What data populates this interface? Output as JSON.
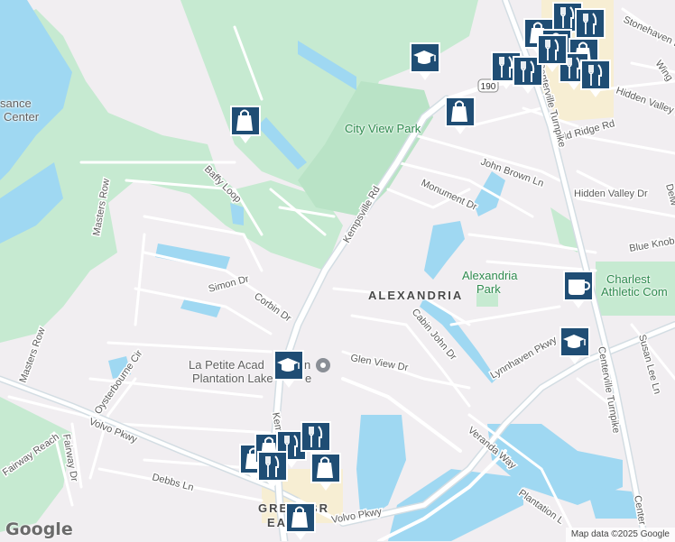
{
  "map": {
    "road_labels": [
      {
        "id": "kempsville-rd",
        "text": "Kempsville Rd"
      },
      {
        "id": "kempsville-rd-south",
        "text": "Kem"
      },
      {
        "id": "john-brown-ln",
        "text": "John Brown Ln"
      },
      {
        "id": "monument-dr",
        "text": "Monument Dr"
      },
      {
        "id": "hidden-valley-dr",
        "text": "Hidden Valley Dr"
      },
      {
        "id": "hidden-valley-rd",
        "text": "Hidden Valley Rd"
      },
      {
        "id": "old-ridge-rd",
        "text": "Old Ridge Rd"
      },
      {
        "id": "stonehaven-dr",
        "text": "Stonehaven Dr"
      },
      {
        "id": "wing",
        "text": "Wing"
      },
      {
        "id": "centerville-tpk-north",
        "text": "Centerville Turnpike"
      },
      {
        "id": "centerville-tpk-south",
        "text": "Centerville Turnpike"
      },
      {
        "id": "center-bottom",
        "text": "Center"
      },
      {
        "id": "blue-knob",
        "text": "Blue Knob"
      },
      {
        "id": "delw",
        "text": "Delw"
      },
      {
        "id": "baffy-loop",
        "text": "Baffy Loop"
      },
      {
        "id": "masters-row-north",
        "text": "Masters Row"
      },
      {
        "id": "masters-row-south",
        "text": "Masters Row"
      },
      {
        "id": "simon-dr",
        "text": "Simon Dr"
      },
      {
        "id": "corbin-dr",
        "text": "Corbin Dr"
      },
      {
        "id": "cabin-john-dr",
        "text": "Cabin John Dr"
      },
      {
        "id": "glen-view-dr",
        "text": "Glen View Dr"
      },
      {
        "id": "lynnhaven-pkwy",
        "text": "Lynnhaven Pkwy"
      },
      {
        "id": "susan-lee-ln",
        "text": "Susan Lee Ln"
      },
      {
        "id": "veranda-way",
        "text": "Veranda Way"
      },
      {
        "id": "volvo-pkwy-west",
        "text": "Volvo Pkwy"
      },
      {
        "id": "volvo-pkwy-south",
        "text": "Volvo Pkwy"
      },
      {
        "id": "oysterbourne-cir",
        "text": "Oysterbourne Cir"
      },
      {
        "id": "fairway-reach",
        "text": "Fairway Reach"
      },
      {
        "id": "fairway-dr",
        "text": "Fairway Dr"
      },
      {
        "id": "debbs-ln",
        "text": "Debbs Ln"
      },
      {
        "id": "plantation-lakes",
        "text": "Plantation L"
      }
    ],
    "area_labels": {
      "alexandria": "ALEXANDRIA",
      "greenbrier": "GREENBR",
      "east": "EAST"
    },
    "park_labels": {
      "city_view_park": "City View Park",
      "alexandria_park_1": "Alexandria",
      "alexandria_park_2": "Park",
      "charleston_1": "Charlest",
      "charleston_2": "Athletic Com"
    },
    "poi_labels": {
      "la_petite_1": "La Petite Acad",
      "la_petite_1b": "n",
      "la_petite_2": "Plantation Lake",
      "la_petite_2b": "e",
      "renaissance_1": "sance",
      "renaissance_2": "Center"
    },
    "route_shield": "190",
    "markers": [
      {
        "id": "shopping-baffy",
        "icon": "shopping-bag-icon"
      },
      {
        "id": "school-north",
        "icon": "school-icon"
      },
      {
        "id": "shopping-kempsville",
        "icon": "shopping-bag-icon"
      },
      {
        "id": "restaurant-ne-1",
        "icon": "restaurant-icon"
      },
      {
        "id": "restaurant-ne-2",
        "icon": "restaurant-icon"
      },
      {
        "id": "shopping-ne-1",
        "icon": "shopping-bag-icon"
      },
      {
        "id": "restaurant-ne-3",
        "icon": "restaurant-icon"
      },
      {
        "id": "shopping-ne-2",
        "icon": "shopping-bag-icon"
      },
      {
        "id": "restaurant-ne-4",
        "icon": "restaurant-icon"
      },
      {
        "id": "shopping-ne-3",
        "icon": "shopping-bag-icon"
      },
      {
        "id": "restaurant-ne-5",
        "icon": "restaurant-icon"
      },
      {
        "id": "restaurant-ne-6",
        "icon": "restaurant-icon"
      },
      {
        "id": "restaurant-ne-7",
        "icon": "restaurant-icon"
      },
      {
        "id": "cafe-east",
        "icon": "cafe-icon"
      },
      {
        "id": "school-east",
        "icon": "school-icon"
      },
      {
        "id": "school-center",
        "icon": "school-icon"
      },
      {
        "id": "shopping-sw-1",
        "icon": "shopping-bag-icon"
      },
      {
        "id": "shopping-sw-2",
        "icon": "shopping-bag-icon"
      },
      {
        "id": "restaurant-sw-1",
        "icon": "restaurant-icon"
      },
      {
        "id": "restaurant-sw-2",
        "icon": "restaurant-icon"
      },
      {
        "id": "restaurant-sw-3",
        "icon": "restaurant-icon"
      },
      {
        "id": "shopping-sw-3",
        "icon": "shopping-bag-icon"
      },
      {
        "id": "shopping-sw-4",
        "icon": "shopping-bag-icon"
      }
    ],
    "google_logo": "Google",
    "attribution": "Map data ©2025 Google",
    "colors": {
      "background": "#f1eef1",
      "water": "#9fd8f2",
      "park": "#c6ead1",
      "marker": "#1f4d74",
      "road": "#ffffff",
      "highway": "#d3dde3"
    }
  }
}
